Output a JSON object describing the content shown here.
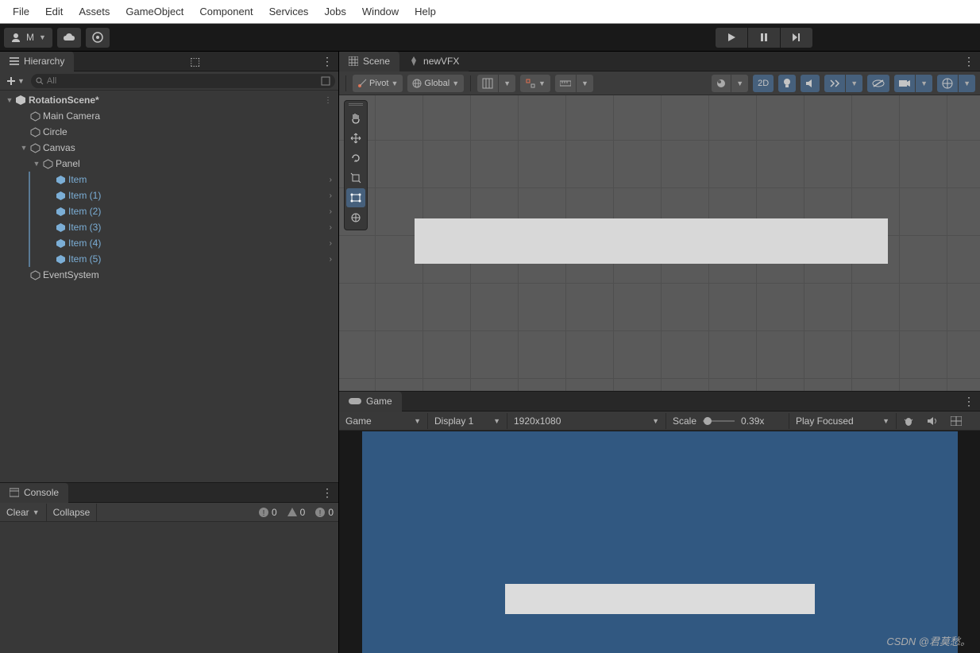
{
  "menubar": [
    "File",
    "Edit",
    "Assets",
    "GameObject",
    "Component",
    "Services",
    "Jobs",
    "Window",
    "Help"
  ],
  "account": {
    "label": "M"
  },
  "hierarchy": {
    "title": "Hierarchy",
    "search_placeholder": "All",
    "scene": "RotationScene*",
    "nodes": {
      "camera": "Main Camera",
      "circle": "Circle",
      "canvas": "Canvas",
      "panel": "Panel",
      "items": [
        "Item",
        "Item (1)",
        "Item (2)",
        "Item (3)",
        "Item (4)",
        "Item (5)"
      ],
      "eventsystem": "EventSystem"
    }
  },
  "console": {
    "title": "Console",
    "clear": "Clear",
    "collapse": "Collapse",
    "counts": {
      "info": "0",
      "warn": "0",
      "error": "0"
    }
  },
  "scene": {
    "tab": "Scene",
    "vfx_tab": "newVFX",
    "pivot": "Pivot",
    "global": "Global",
    "mode_2d": "2D"
  },
  "game": {
    "tab": "Game",
    "mode": "Game",
    "display": "Display 1",
    "resolution": "1920x1080",
    "scale_label": "Scale",
    "scale_value": "0.39x",
    "play_mode": "Play Focused"
  },
  "watermark": "CSDN @君莫愁。"
}
